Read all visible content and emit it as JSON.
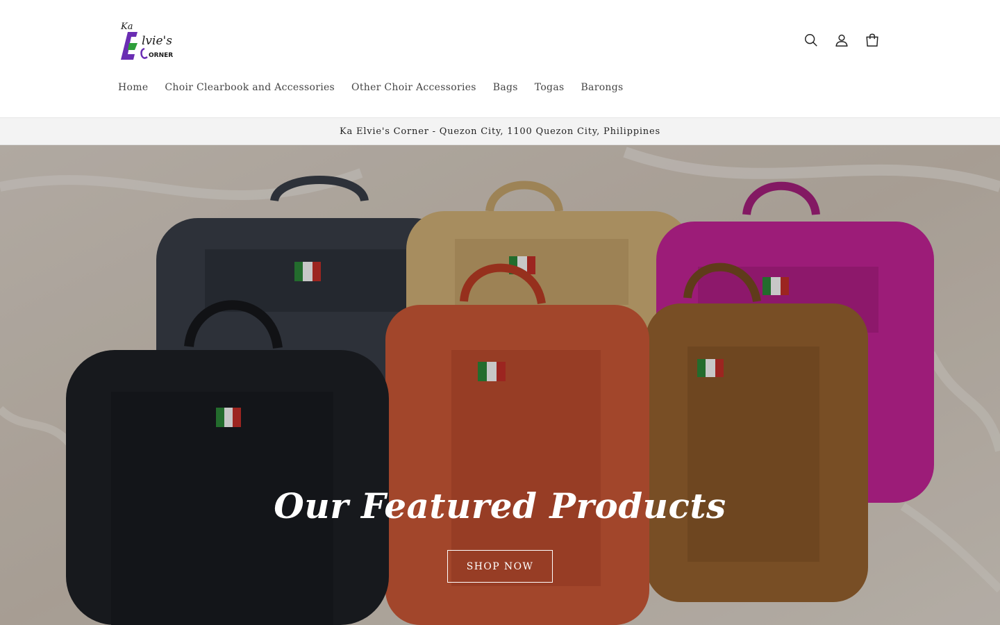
{
  "brand": {
    "logo_text_ka": "Ka",
    "logo_text_elvies": "Elvie's",
    "logo_text_corner": "CORNER",
    "colors": {
      "accent_green": "#2e9e3a",
      "accent_purple": "#6a2db3",
      "dark": "#1a1a1a"
    }
  },
  "header": {
    "icons": [
      "search-icon",
      "account-icon",
      "cart-icon"
    ]
  },
  "nav": {
    "items": [
      {
        "label": "Home"
      },
      {
        "label": "Choir Clearbook and Accessories"
      },
      {
        "label": "Other Choir Accessories"
      },
      {
        "label": "Bags"
      },
      {
        "label": "Togas"
      },
      {
        "label": "Barongs"
      }
    ]
  },
  "announcement": {
    "text": "Ka Elvie's Corner - Quezon City, 1100 Quezon City, Philippines"
  },
  "hero": {
    "title": "Our Featured Products",
    "button_label": "SHOP NOW",
    "bag_colors": [
      "#3a3f4a",
      "#d6b57a",
      "#c8259a",
      "#1e2026",
      "#d05a38",
      "#9a6430"
    ]
  }
}
